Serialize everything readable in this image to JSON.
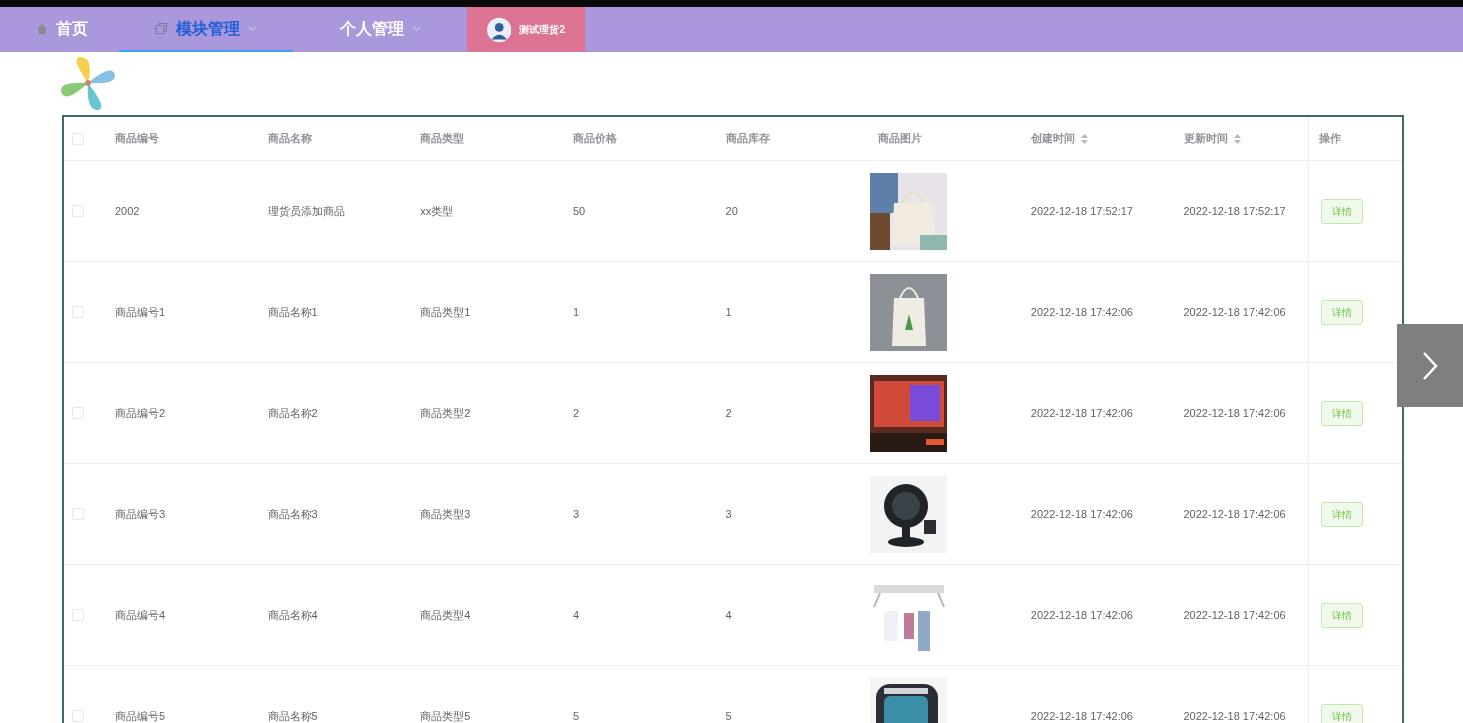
{
  "nav": {
    "items": [
      {
        "label": "首页",
        "selected": false
      },
      {
        "label": "模块管理",
        "selected": true
      },
      {
        "label": "个人管理",
        "selected": false
      }
    ],
    "user": {
      "name": "测试理货2"
    }
  },
  "table": {
    "columns": [
      "商品编号",
      "商品名称",
      "商品类型",
      "商品价格",
      "商品库存",
      "商品图片",
      "创建时间",
      "更新时间",
      "操作"
    ],
    "header_checked": false,
    "rows": [
      {
        "checked": false,
        "cells": [
          "2002",
          "理货员添加商品",
          "xx类型",
          "50",
          "20"
        ],
        "created": "2022-12-18 17:52:17",
        "updated": "2022-12-18 17:52:17",
        "action": "详情"
      },
      {
        "checked": false,
        "cells": [
          "商品编号1",
          "商品名称1",
          "商品类型1",
          "1",
          "1"
        ],
        "created": "2022-12-18 17:42:06",
        "updated": "2022-12-18 17:42:06",
        "action": "详情"
      },
      {
        "checked": false,
        "cells": [
          "商品编号2",
          "商品名称2",
          "商品类型2",
          "2",
          "2"
        ],
        "created": "2022-12-18 17:42:06",
        "updated": "2022-12-18 17:42:06",
        "action": "详情"
      },
      {
        "checked": false,
        "cells": [
          "商品编号3",
          "商品名称3",
          "商品类型3",
          "3",
          "3"
        ],
        "created": "2022-12-18 17:42:06",
        "updated": "2022-12-18 17:42:06",
        "action": "详情"
      },
      {
        "checked": false,
        "cells": [
          "商品编号4",
          "商品名称4",
          "商品类型4",
          "4",
          "4"
        ],
        "created": "2022-12-18 17:42:06",
        "updated": "2022-12-18 17:42:06",
        "action": "详情"
      },
      {
        "checked": false,
        "cells": [
          "商品编号5",
          "商品名称5",
          "商品类型5",
          "5",
          "5"
        ],
        "created": "2022-12-18 17:42:06",
        "updated": "2022-12-18 17:42:06",
        "action": "详情"
      }
    ]
  }
}
